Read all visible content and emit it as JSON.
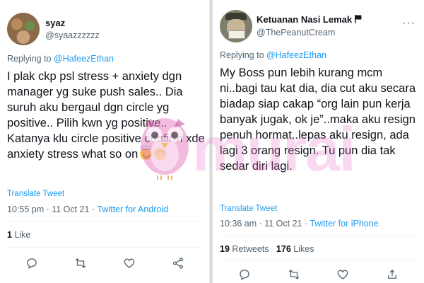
{
  "left": {
    "name": "syaz",
    "handle": "@syaazzzzzz",
    "replying_prefix": "Replying to ",
    "replying_to": "@HafeezEthan",
    "text": "I plak ckp psl stress + anxiety dgn manager yg suke push sales.. Dia suruh aku bergaul dgn circle yg positive.. Pilih kwn yg positive.. Katanya klu circle positive confirm xde anxiety stress what so on",
    "translate": "Translate Tweet",
    "time": "10:55 pm · 11 Oct 21 · ",
    "source": "Twitter for Android",
    "likes_count": "1",
    "likes_label": "Like",
    "icons": [
      "reply-icon",
      "retweet-icon",
      "like-icon",
      "share-icon"
    ]
  },
  "right": {
    "name": "Ketuanan Nasi Lemak",
    "handle": "@ThePeanutCream",
    "replying_prefix": "Replying to ",
    "replying_to": "@HafeezEthan",
    "text": "My Boss pun lebih kurang mcm ni..bagi tau kat dia, dia cut aku secara biadap siap cakap “org lain pun kerja banyak jugak, ok je”..maka aku resign penuh hormat..lepas aku resign, ada lagi 3 orang resign. Tu pun dia tak sedar diri lagi.",
    "translate": "Translate Tweet",
    "time": "10:36 am · 11 Oct 21 · ",
    "source": "Twitter for iPhone",
    "retweets_count": "19",
    "retweets_label": "Retweets",
    "likes_count": "176",
    "likes_label": "Likes",
    "icons": [
      "reply-icon",
      "retweet-icon",
      "like-icon",
      "share-icon"
    ]
  },
  "watermark": "murai",
  "colors": {
    "link": "#1d9bf0",
    "secondary_text": "#536471",
    "primary_text": "#0f1419",
    "watermark": "#eb78c8"
  }
}
